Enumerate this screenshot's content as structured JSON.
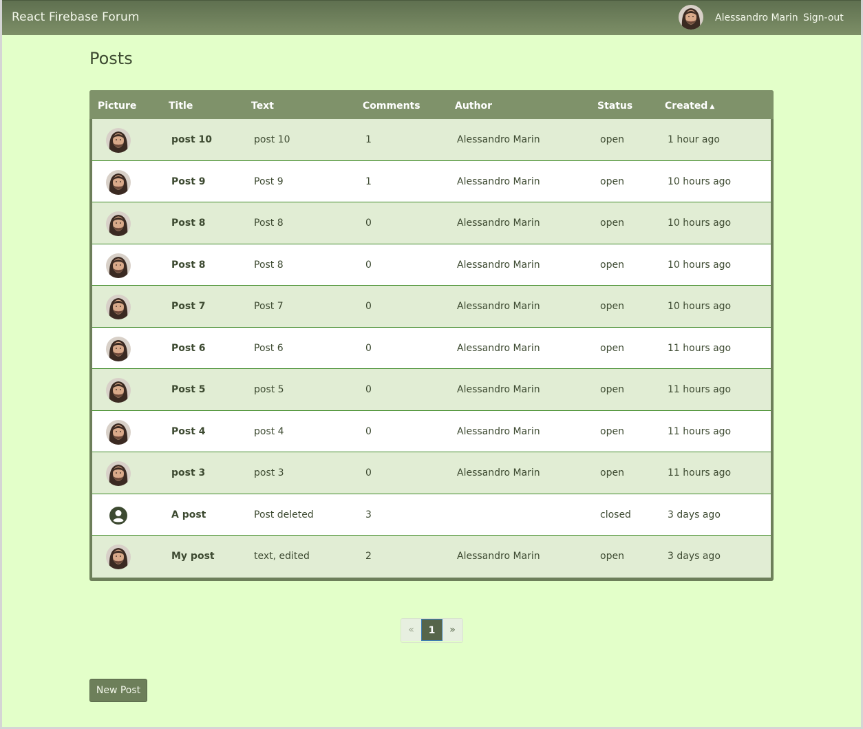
{
  "header": {
    "brand": "React Firebase Forum",
    "user_name": "Alessandro Marin",
    "signout_label": "Sign-out"
  },
  "page": {
    "title": "Posts"
  },
  "table": {
    "columns": [
      "Picture",
      "Title",
      "Text",
      "Comments",
      "Author",
      "Status",
      "Created"
    ],
    "sorted_column": "Created",
    "sort_direction": "ascending",
    "rows": [
      {
        "avatar": "user-photo",
        "title": "post 10",
        "text": "post 10",
        "comments": "1",
        "author": "Alessandro Marin",
        "status": "open",
        "created": "1 hour ago"
      },
      {
        "avatar": "user-photo",
        "title": "Post 9",
        "text": "Post 9",
        "comments": "1",
        "author": "Alessandro Marin",
        "status": "open",
        "created": "10 hours ago"
      },
      {
        "avatar": "user-photo",
        "title": "Post 8",
        "text": "Post 8",
        "comments": "0",
        "author": "Alessandro Marin",
        "status": "open",
        "created": "10 hours ago"
      },
      {
        "avatar": "user-photo",
        "title": "Post 8",
        "text": "Post 8",
        "comments": "0",
        "author": "Alessandro Marin",
        "status": "open",
        "created": "10 hours ago"
      },
      {
        "avatar": "user-photo",
        "title": "Post 7",
        "text": "Post 7",
        "comments": "0",
        "author": "Alessandro Marin",
        "status": "open",
        "created": "10 hours ago"
      },
      {
        "avatar": "user-photo",
        "title": "Post 6",
        "text": "Post 6",
        "comments": "0",
        "author": "Alessandro Marin",
        "status": "open",
        "created": "11 hours ago"
      },
      {
        "avatar": "user-photo",
        "title": "Post 5",
        "text": "post 5",
        "comments": "0",
        "author": "Alessandro Marin",
        "status": "open",
        "created": "11 hours ago"
      },
      {
        "avatar": "user-photo",
        "title": "Post 4",
        "text": "post 4",
        "comments": "0",
        "author": "Alessandro Marin",
        "status": "open",
        "created": "11 hours ago"
      },
      {
        "avatar": "user-photo",
        "title": "post 3",
        "text": "post 3",
        "comments": "0",
        "author": "Alessandro Marin",
        "status": "open",
        "created": "11 hours ago"
      },
      {
        "avatar": "account-circle-icon",
        "title": "A post",
        "text": "Post deleted",
        "comments": "3",
        "author": "",
        "status": "closed",
        "created": "3 days ago"
      },
      {
        "avatar": "user-photo",
        "title": "My post",
        "text": "text, edited",
        "comments": "2",
        "author": "Alessandro Marin",
        "status": "open",
        "created": "3 days ago"
      }
    ]
  },
  "pagination": {
    "prev": "«",
    "current": "1",
    "next": "»"
  },
  "actions": {
    "new_post_label": "New Post"
  },
  "colors": {
    "page_bg": "#e3ffc9",
    "navbar": "#6d7f5a",
    "row_odd": "#e1edd4",
    "row_even": "#ffffff",
    "row_border": "#3f8a28"
  }
}
